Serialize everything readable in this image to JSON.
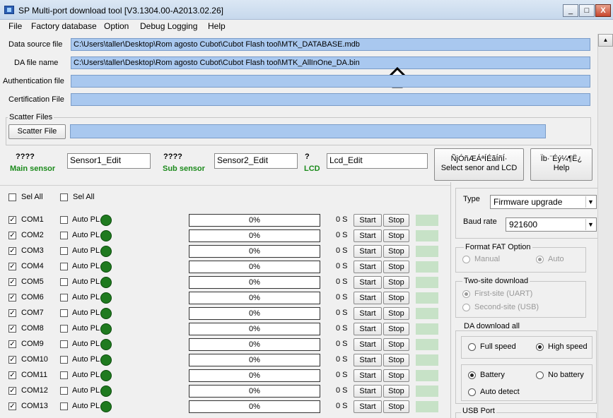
{
  "window": {
    "title": "SP Multi-port download tool [V3.1304.00-A2013.02.26]",
    "controls": {
      "minimize": "_",
      "maximize": "□",
      "close": "X"
    }
  },
  "menu": [
    "File",
    "Factory database",
    "Option",
    "Debug Logging",
    "Help"
  ],
  "files": {
    "data_source_label": "Data source file",
    "data_source_value": "C:\\Users\\taller\\Desktop\\Rom agosto Cubot\\Cubot Flash tool\\MTK_DATABASE.mdb",
    "da_label": "DA file name",
    "da_value": "C:\\Users\\taller\\Desktop\\Rom agosto Cubot\\Cubot Flash tool\\MTK_AllInOne_DA.bin",
    "auth_label": "Authentication file",
    "auth_value": "",
    "cert_label": "Certification File",
    "cert_value": ""
  },
  "scatter": {
    "group_label": "Scatter Files",
    "button": "Scatter File",
    "value": ""
  },
  "sensors": {
    "main_title": "????",
    "main_sub": "Main sensor",
    "main_edit": "Sensor1_Edit",
    "sub_title": "????",
    "sub_sub": "Sub sensor",
    "sub_edit": "Sensor2_Edit",
    "lcd_title": "?",
    "lcd_sub": "LCD",
    "lcd_edit": "Lcd_Edit",
    "select_button_line1": "ÑjÓñÆÁªÍÉãÍñÍ·",
    "select_button_line2": "Select senor and LCD",
    "help_button_line1": "Ïb·¨Éý¼¶Ë¿",
    "help_button_line2": "Help"
  },
  "sel_all": [
    "Sel All",
    "Sel All"
  ],
  "ports": [
    {
      "name": "COM1",
      "auto": "Auto PL",
      "progress": "0%",
      "time": "0 S",
      "start": "Start",
      "stop": "Stop"
    },
    {
      "name": "COM2",
      "auto": "Auto PL",
      "progress": "0%",
      "time": "0 S",
      "start": "Start",
      "stop": "Stop"
    },
    {
      "name": "COM3",
      "auto": "Auto PL",
      "progress": "0%",
      "time": "0 S",
      "start": "Start",
      "stop": "Stop"
    },
    {
      "name": "COM4",
      "auto": "Auto PL",
      "progress": "0%",
      "time": "0 S",
      "start": "Start",
      "stop": "Stop"
    },
    {
      "name": "COM5",
      "auto": "Auto PL",
      "progress": "0%",
      "time": "0 S",
      "start": "Start",
      "stop": "Stop"
    },
    {
      "name": "COM6",
      "auto": "Auto PL",
      "progress": "0%",
      "time": "0 S",
      "start": "Start",
      "stop": "Stop"
    },
    {
      "name": "COM7",
      "auto": "Auto PL",
      "progress": "0%",
      "time": "0 S",
      "start": "Start",
      "stop": "Stop"
    },
    {
      "name": "COM8",
      "auto": "Auto PL",
      "progress": "0%",
      "time": "0 S",
      "start": "Start",
      "stop": "Stop"
    },
    {
      "name": "COM9",
      "auto": "Auto PL",
      "progress": "0%",
      "time": "0 S",
      "start": "Start",
      "stop": "Stop"
    },
    {
      "name": "COM10",
      "auto": "Auto PL",
      "progress": "0%",
      "time": "0 S",
      "start": "Start",
      "stop": "Stop"
    },
    {
      "name": "COM11",
      "auto": "Auto PL",
      "progress": "0%",
      "time": "0 S",
      "start": "Start",
      "stop": "Stop"
    },
    {
      "name": "COM12",
      "auto": "Auto PL",
      "progress": "0%",
      "time": "0 S",
      "start": "Start",
      "stop": "Stop"
    },
    {
      "name": "COM13",
      "auto": "Auto PL",
      "progress": "0%",
      "time": "0 S",
      "start": "Start",
      "stop": "Stop"
    }
  ],
  "settings": {
    "type_label": "Type",
    "type_value": "Firmware upgrade",
    "baud_label": "Baud rate",
    "baud_value": "921600",
    "format_fat": {
      "title": "Format FAT Option",
      "manual": "Manual",
      "auto": "Auto"
    },
    "two_site": {
      "title": "Two-site download",
      "first": "First-site (UART)",
      "second": "Second-site (USB)"
    },
    "da_download": {
      "title": "DA download all",
      "full": "Full speed",
      "high": "High speed",
      "battery": "Battery",
      "no_battery": "No battery",
      "auto_detect": "Auto detect"
    },
    "usb_port": {
      "title": "USB Port"
    }
  },
  "colors": {
    "path_fill": "#a9c8ef",
    "led_green": "#1f7a1f",
    "sensor_green": "#1b8a1b",
    "status_cell": "#c7e2c7"
  }
}
